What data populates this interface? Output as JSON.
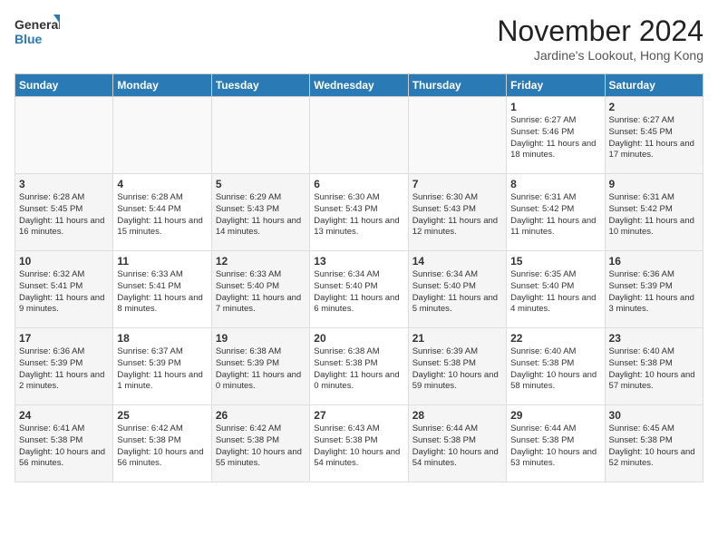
{
  "logo": {
    "line1": "General",
    "line2": "Blue"
  },
  "title": "November 2024",
  "location": "Jardine's Lookout, Hong Kong",
  "days_of_week": [
    "Sunday",
    "Monday",
    "Tuesday",
    "Wednesday",
    "Thursday",
    "Friday",
    "Saturday"
  ],
  "weeks": [
    [
      {
        "day": "",
        "info": ""
      },
      {
        "day": "",
        "info": ""
      },
      {
        "day": "",
        "info": ""
      },
      {
        "day": "",
        "info": ""
      },
      {
        "day": "",
        "info": ""
      },
      {
        "day": "1",
        "info": "Sunrise: 6:27 AM\nSunset: 5:46 PM\nDaylight: 11 hours and 18 minutes."
      },
      {
        "day": "2",
        "info": "Sunrise: 6:27 AM\nSunset: 5:45 PM\nDaylight: 11 hours and 17 minutes."
      }
    ],
    [
      {
        "day": "3",
        "info": "Sunrise: 6:28 AM\nSunset: 5:45 PM\nDaylight: 11 hours and 16 minutes."
      },
      {
        "day": "4",
        "info": "Sunrise: 6:28 AM\nSunset: 5:44 PM\nDaylight: 11 hours and 15 minutes."
      },
      {
        "day": "5",
        "info": "Sunrise: 6:29 AM\nSunset: 5:43 PM\nDaylight: 11 hours and 14 minutes."
      },
      {
        "day": "6",
        "info": "Sunrise: 6:30 AM\nSunset: 5:43 PM\nDaylight: 11 hours and 13 minutes."
      },
      {
        "day": "7",
        "info": "Sunrise: 6:30 AM\nSunset: 5:43 PM\nDaylight: 11 hours and 12 minutes."
      },
      {
        "day": "8",
        "info": "Sunrise: 6:31 AM\nSunset: 5:42 PM\nDaylight: 11 hours and 11 minutes."
      },
      {
        "day": "9",
        "info": "Sunrise: 6:31 AM\nSunset: 5:42 PM\nDaylight: 11 hours and 10 minutes."
      }
    ],
    [
      {
        "day": "10",
        "info": "Sunrise: 6:32 AM\nSunset: 5:41 PM\nDaylight: 11 hours and 9 minutes."
      },
      {
        "day": "11",
        "info": "Sunrise: 6:33 AM\nSunset: 5:41 PM\nDaylight: 11 hours and 8 minutes."
      },
      {
        "day": "12",
        "info": "Sunrise: 6:33 AM\nSunset: 5:40 PM\nDaylight: 11 hours and 7 minutes."
      },
      {
        "day": "13",
        "info": "Sunrise: 6:34 AM\nSunset: 5:40 PM\nDaylight: 11 hours and 6 minutes."
      },
      {
        "day": "14",
        "info": "Sunrise: 6:34 AM\nSunset: 5:40 PM\nDaylight: 11 hours and 5 minutes."
      },
      {
        "day": "15",
        "info": "Sunrise: 6:35 AM\nSunset: 5:40 PM\nDaylight: 11 hours and 4 minutes."
      },
      {
        "day": "16",
        "info": "Sunrise: 6:36 AM\nSunset: 5:39 PM\nDaylight: 11 hours and 3 minutes."
      }
    ],
    [
      {
        "day": "17",
        "info": "Sunrise: 6:36 AM\nSunset: 5:39 PM\nDaylight: 11 hours and 2 minutes."
      },
      {
        "day": "18",
        "info": "Sunrise: 6:37 AM\nSunset: 5:39 PM\nDaylight: 11 hours and 1 minute."
      },
      {
        "day": "19",
        "info": "Sunrise: 6:38 AM\nSunset: 5:39 PM\nDaylight: 11 hours and 0 minutes."
      },
      {
        "day": "20",
        "info": "Sunrise: 6:38 AM\nSunset: 5:38 PM\nDaylight: 11 hours and 0 minutes."
      },
      {
        "day": "21",
        "info": "Sunrise: 6:39 AM\nSunset: 5:38 PM\nDaylight: 10 hours and 59 minutes."
      },
      {
        "day": "22",
        "info": "Sunrise: 6:40 AM\nSunset: 5:38 PM\nDaylight: 10 hours and 58 minutes."
      },
      {
        "day": "23",
        "info": "Sunrise: 6:40 AM\nSunset: 5:38 PM\nDaylight: 10 hours and 57 minutes."
      }
    ],
    [
      {
        "day": "24",
        "info": "Sunrise: 6:41 AM\nSunset: 5:38 PM\nDaylight: 10 hours and 56 minutes."
      },
      {
        "day": "25",
        "info": "Sunrise: 6:42 AM\nSunset: 5:38 PM\nDaylight: 10 hours and 56 minutes."
      },
      {
        "day": "26",
        "info": "Sunrise: 6:42 AM\nSunset: 5:38 PM\nDaylight: 10 hours and 55 minutes."
      },
      {
        "day": "27",
        "info": "Sunrise: 6:43 AM\nSunset: 5:38 PM\nDaylight: 10 hours and 54 minutes."
      },
      {
        "day": "28",
        "info": "Sunrise: 6:44 AM\nSunset: 5:38 PM\nDaylight: 10 hours and 54 minutes."
      },
      {
        "day": "29",
        "info": "Sunrise: 6:44 AM\nSunset: 5:38 PM\nDaylight: 10 hours and 53 minutes."
      },
      {
        "day": "30",
        "info": "Sunrise: 6:45 AM\nSunset: 5:38 PM\nDaylight: 10 hours and 52 minutes."
      }
    ]
  ]
}
